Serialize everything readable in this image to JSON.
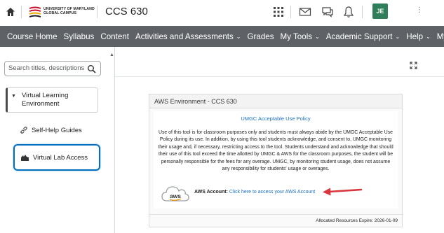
{
  "header": {
    "university_line1": "UNIVERSITY OF MARYLAND",
    "university_line2": "GLOBAL CAMPUS",
    "course_title": "CCS 630",
    "avatar_initials": "JE"
  },
  "nav": {
    "items": [
      {
        "label": "Course Home",
        "dropdown": false
      },
      {
        "label": "Syllabus",
        "dropdown": false
      },
      {
        "label": "Content",
        "dropdown": false
      },
      {
        "label": "Activities and Assessments",
        "dropdown": true
      },
      {
        "label": "Grades",
        "dropdown": false
      },
      {
        "label": "My Tools",
        "dropdown": true
      },
      {
        "label": "Academic Support",
        "dropdown": true
      },
      {
        "label": "Help",
        "dropdown": true
      },
      {
        "label": "MyUMGC",
        "dropdown": false
      }
    ]
  },
  "sidebar": {
    "search_placeholder": "Search titles, descriptions",
    "module_label": "Virtual Learning Environment",
    "topics": [
      {
        "label": "Self-Help Guides",
        "icon": "link-icon"
      },
      {
        "label": "Virtual Lab Access",
        "icon": "lab-icon"
      }
    ]
  },
  "panel": {
    "title": "AWS Environment - CCS 630",
    "policy_link": "UMGC Acceptable Use Policy",
    "policy_text": "Use of this tool is for classroom purposes only and students must always abide by the UMGC Acceptable Use Policy during its use. In addition, by using this tool students acknowledge, and consent to, UMGC monitoring their usage and, if necessary, restricting access to the tool. Students understand and acknowledge that should their use of this tool exceed the time allotted by UMGC & AWS for the classroom purposes, the student will be personally responsible for the fees for any overage. UMGC, by monitoring student usage, does not assume any responsibility for students' usage or overages.",
    "aws_logo_text": "aws",
    "aws_account_label": "AWS Account:",
    "aws_account_link": "Click here to access your AWS Account",
    "expires_label": "Allocated Resources Expire:",
    "expires_date": "2026-01-09"
  },
  "colors": {
    "nav_bg": "#5e6266",
    "link": "#1a6fc4",
    "avatar_bg": "#2e7d5b",
    "focus_border": "#006fbf",
    "arrow": "#d9363e"
  }
}
